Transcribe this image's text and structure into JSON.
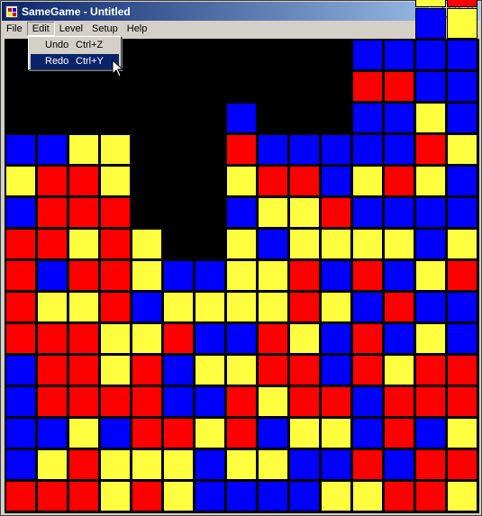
{
  "window": {
    "title": "SameGame - Untitled"
  },
  "menu": [
    "File",
    "Edit",
    "Level",
    "Setup",
    "Help"
  ],
  "edit_menu": [
    {
      "label": "Undo",
      "shortcut": "Ctrl+Z"
    },
    {
      "label": "Redo",
      "shortcut": "Ctrl+Y"
    }
  ],
  "board": {
    "colors": {
      "R": "#ff0000",
      "B": "#0000ff",
      "Y": "#ffff40",
      "empty": "#000000"
    },
    "columns": [
      "RBBBBRRRRBYB",
      "RYBRRRYBRRRB",
      "RRYRRRYRYRRY",
      "YYBRYYRRRRYY",
      "RYRRRYBYY",
      "YYRBBRYB",
      "BBYBYBYB",
      "BYRRYBYYYBYRB",
      "BYBYRRYYBYRB",
      "BBYRRYRRYYRB",
      "YBYRBBYBYRBB",
      "YRBBRRBRYBYBBRB",
      "RBRRYBRBYBRBBRB",
      "RRBRRYBYBBYRYBBBY",
      "YRYRRBBRYBBYBBBYR"
    ]
  }
}
